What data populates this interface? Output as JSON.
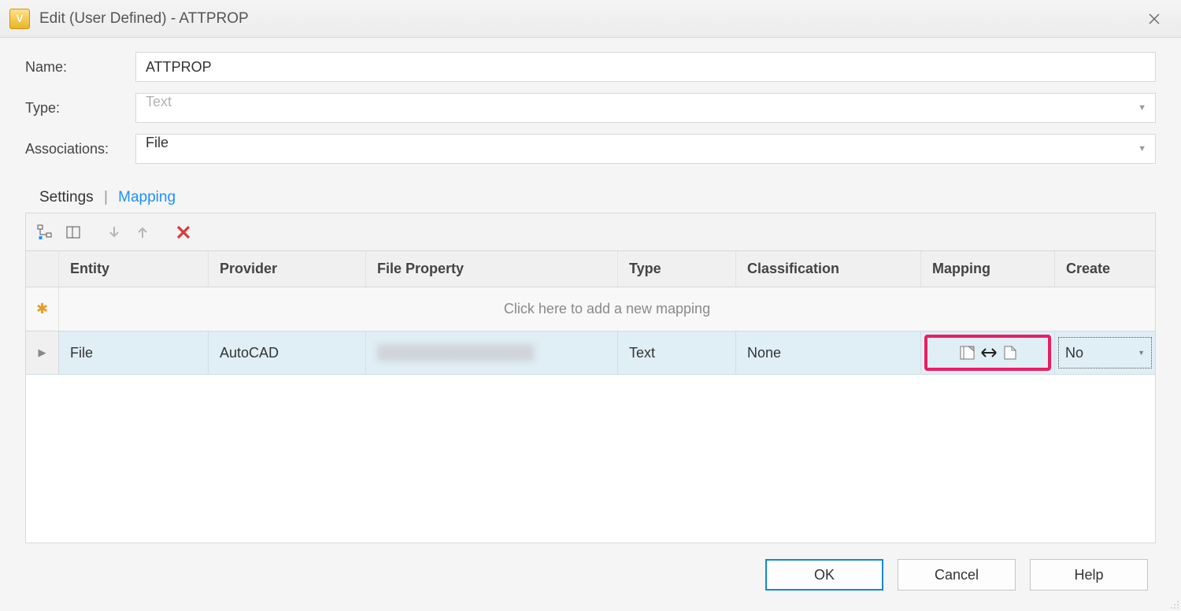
{
  "window": {
    "title": "Edit (User Defined) - ATTPROP"
  },
  "form": {
    "name_label": "Name:",
    "name_value": "ATTPROP",
    "type_label": "Type:",
    "type_value": "Text",
    "assoc_label": "Associations:",
    "assoc_value": "File"
  },
  "subtabs": {
    "settings": "Settings",
    "mapping": "Mapping"
  },
  "grid": {
    "headers": {
      "entity": "Entity",
      "provider": "Provider",
      "fileprop": "File Property",
      "type": "Type",
      "classification": "Classification",
      "mapping": "Mapping",
      "create": "Create"
    },
    "new_row_prompt": "Click here to add a new mapping",
    "rows": [
      {
        "entity": "File",
        "provider": "AutoCAD",
        "fileprop": "",
        "type": "Text",
        "classification": "None",
        "create": "No"
      }
    ]
  },
  "buttons": {
    "ok": "OK",
    "cancel": "Cancel",
    "help": "Help"
  }
}
